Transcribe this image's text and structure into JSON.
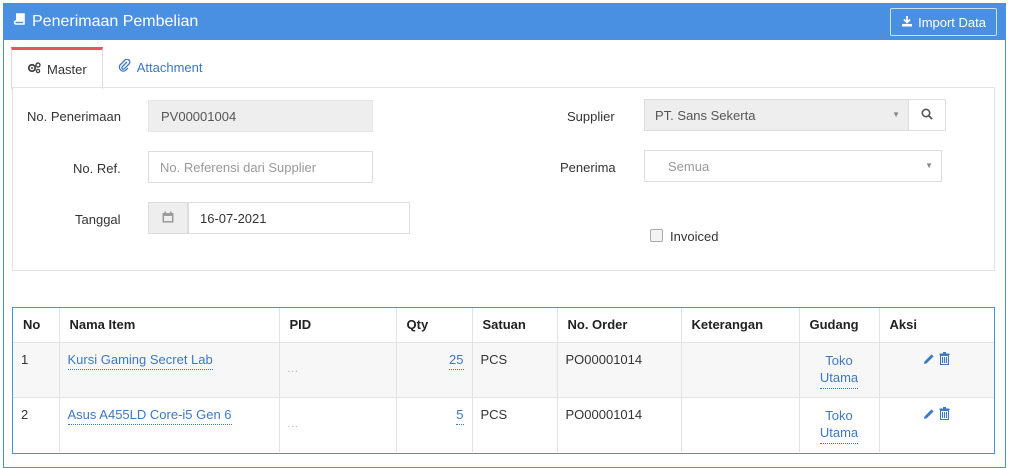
{
  "header": {
    "title": "Penerimaan Pembelian",
    "import_label": "Import Data"
  },
  "tabs": [
    {
      "label": "Master",
      "active": true
    },
    {
      "label": "Attachment",
      "active": false
    }
  ],
  "form": {
    "no_penerimaan_label": "No. Penerimaan",
    "no_penerimaan_value": "PV00001004",
    "no_ref_label": "No. Ref.",
    "no_ref_placeholder": "No. Referensi dari Supplier",
    "tanggal_label": "Tanggal",
    "tanggal_value": "16-07-2021",
    "supplier_label": "Supplier",
    "supplier_value": "PT. Sans Sekerta",
    "penerima_label": "Penerima",
    "penerima_value": "Semua",
    "invoiced_label": "Invoiced",
    "invoiced_checked": false
  },
  "table": {
    "headers": [
      "No",
      "Nama Item",
      "PID",
      "Qty",
      "Satuan",
      "No. Order",
      "Keterangan",
      "Gudang",
      "Aksi"
    ],
    "rows": [
      {
        "no": "1",
        "nama_item": "Kursi Gaming Secret Lab",
        "pid": "...",
        "qty": "25",
        "satuan": "PCS",
        "no_order": "PO00001014",
        "keterangan": "",
        "gudang_line1": "Toko",
        "gudang_line2": "Utama"
      },
      {
        "no": "2",
        "nama_item": "Asus A455LD Core-i5 Gen 6",
        "pid": "...",
        "qty": "5",
        "satuan": "PCS",
        "no_order": "PO00001014",
        "keterangan": "",
        "gudang_line1": "Toko",
        "gudang_line2": "Utama"
      }
    ]
  },
  "colors": {
    "primary": "#4a90e2",
    "link": "#3c78c3",
    "active_tab_accent": "#e45659"
  }
}
